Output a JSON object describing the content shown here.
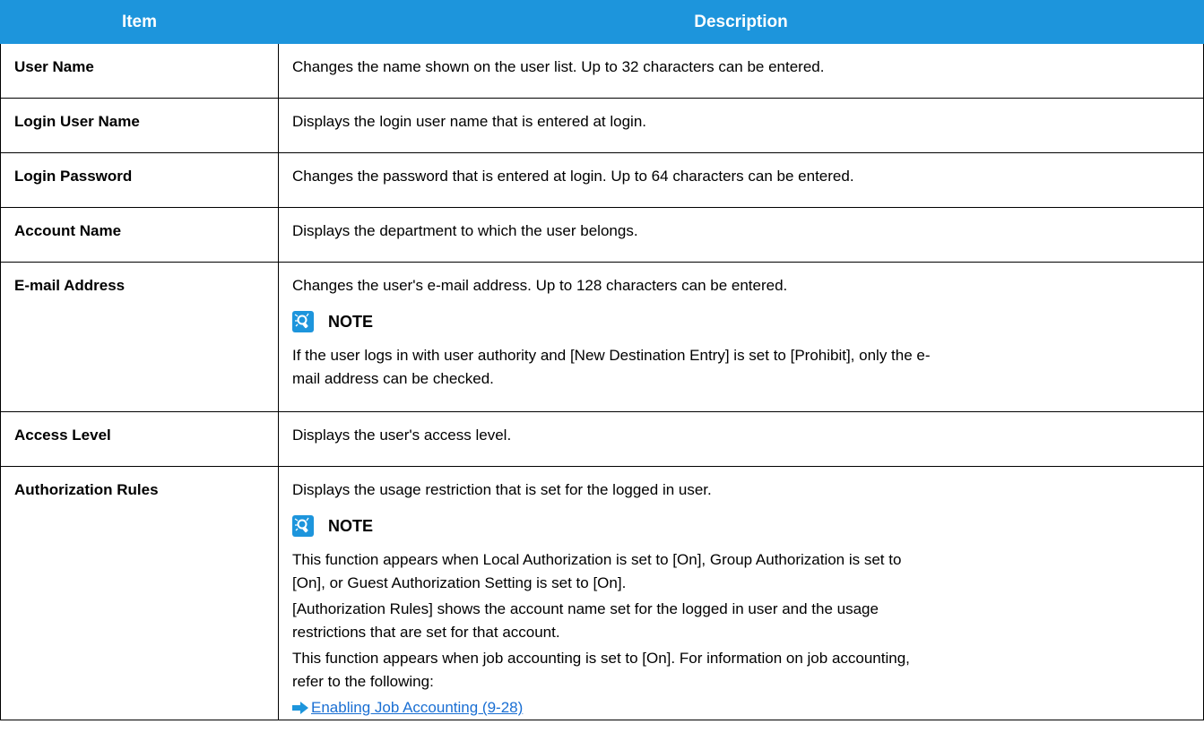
{
  "header": {
    "item": "Item",
    "description": "Description"
  },
  "rows": [
    {
      "item": "User Name",
      "text": "Changes the name shown on the user list. Up to 32 characters can be entered."
    },
    {
      "item": "Login User Name",
      "text": "Displays the login user name that is entered at login."
    },
    {
      "item": "Login Password",
      "text": "Changes the password that is entered at login. Up to 64 characters can be entered."
    },
    {
      "item": "Account Name",
      "text": "Displays the department to which the user belongs."
    },
    {
      "item": "E-mail Address",
      "text": "Changes the user's e-mail address. Up to 128 characters can be entered.",
      "note_label": "NOTE",
      "note_text_1": "If the user logs in with user authority and [New Destination Entry] is set to [Prohibit], only the e-",
      "note_text_2": "mail address can be checked."
    },
    {
      "item": "Access Level",
      "text": "Displays the user's access level."
    },
    {
      "item": "Authorization Rules",
      "text": "Displays the usage restriction that is set for the logged in user.",
      "note_label": "NOTE",
      "p1_line1": "This function appears when Local Authorization is set to [On], Group Authorization is set to",
      "p1_line2": "[On], or Guest Authorization Setting is set to [On].",
      "p2_line1": "[Authorization Rules] shows the account name set for the logged in user and the usage",
      "p2_line2": "restrictions that are set for that account.",
      "p3_line1": "This function appears when job accounting is set to [On]. For information on job accounting,",
      "p3_line2": "refer to the following:",
      "link": "Enabling Job Accounting (9-28)"
    }
  ],
  "colors": {
    "header_bg": "#1d95dc",
    "header_text": "#ffffff",
    "link": "#1a6fd3",
    "note_icon": "#1d95dc"
  },
  "icons": {
    "note": "note-lightbulb-icon",
    "link": "arrow-right-icon"
  }
}
